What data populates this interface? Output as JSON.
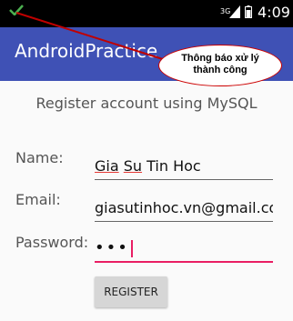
{
  "status_bar": {
    "time": "4:09",
    "network": "3G"
  },
  "app_bar": {
    "title": "AndroidPractice"
  },
  "form": {
    "heading": "Register account using MySQL",
    "name_label": "Name:",
    "name_value_parts": [
      "Gia",
      "Su",
      "Tin Hoc"
    ],
    "email_label": "Email:",
    "email_value": "giasutinhoc.vn@gmail.com",
    "password_label": "Password:",
    "password_masked": "•••",
    "register_label": "REGISTER"
  },
  "annotation": {
    "line1": "Thông báo xử lý",
    "line2": "thành công"
  },
  "colors": {
    "app_bar": "#3f51b5",
    "accent": "#e91e63",
    "annotation_arrow": "#c00000",
    "check": "#4caf50"
  },
  "icons": [
    "check-icon",
    "signal-icon",
    "battery-icon"
  ]
}
